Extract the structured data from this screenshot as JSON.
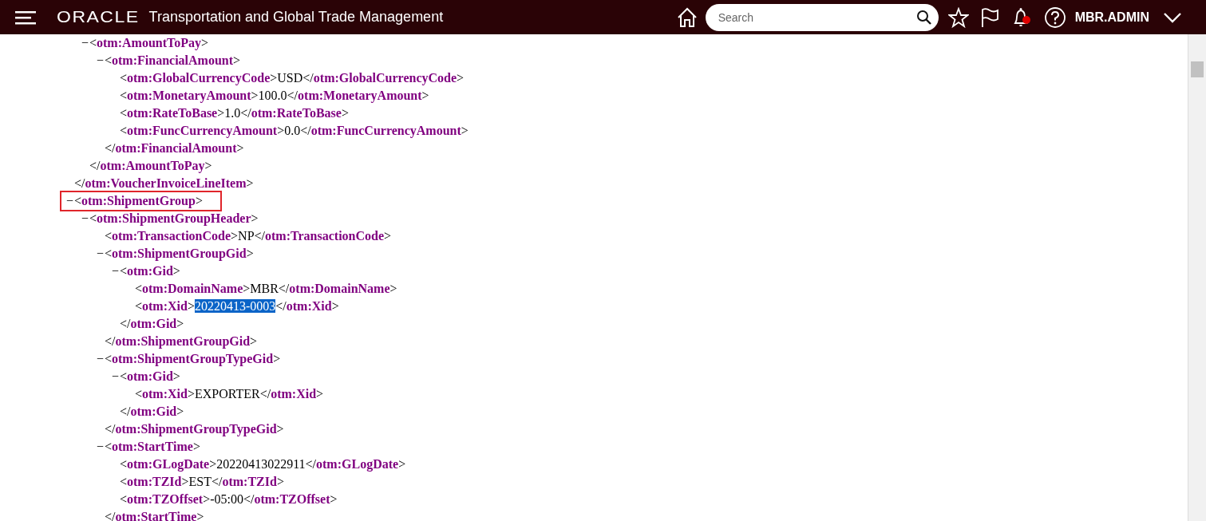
{
  "header": {
    "brand": "ORACLE",
    "title": "Transportation and Global Trade Management",
    "search": {
      "placeholder": "Search"
    },
    "notifications": {
      "unread": true
    },
    "user": "MBR.ADMIN"
  },
  "xml": [
    {
      "close": "</**otm:VoucherInvoiceLineItem**>",
      "children": [
        {
          "toggle": "−",
          "open": "<**otm:AmountToPay**>",
          "close": "</**otm:AmountToPay**>",
          "children": [
            {
              "toggle": "−",
              "open": "<**otm:FinancialAmount**>",
              "close": "</**otm:FinancialAmount**>",
              "children": [
                {
                  "open": "<**otm:GlobalCurrencyCode**>",
                  "value": "USD",
                  "selected": false,
                  "close": "</**otm:GlobalCurrencyCode**>"
                },
                {
                  "open": "<**otm:MonetaryAmount**>",
                  "value": "100.0",
                  "selected": false,
                  "close": "</**otm:MonetaryAmount**>"
                },
                {
                  "open": "<**otm:RateToBase**>",
                  "value": "1.0",
                  "selected": false,
                  "close": "</**otm:RateToBase**>"
                },
                {
                  "open": "<**otm:FuncCurrencyAmount**>",
                  "value": "0.0",
                  "selected": false,
                  "close": "</**otm:FuncCurrencyAmount**>"
                }
              ]
            }
          ]
        }
      ]
    },
    {
      "toggle": "−",
      "open": "<**otm:ShipmentGroup**>",
      "outlined": true,
      "children": [
        {
          "toggle": "−",
          "open": "<**otm:ShipmentGroupHeader**>",
          "children": [
            {
              "open": "<**otm:TransactionCode**>",
              "value": "NP",
              "selected": false,
              "close": "</**otm:TransactionCode**>"
            },
            {
              "toggle": "−",
              "open": "<**otm:ShipmentGroupGid**>",
              "close": "</**otm:ShipmentGroupGid**>",
              "children": [
                {
                  "toggle": "−",
                  "open": "<**otm:Gid**>",
                  "close": "</**otm:Gid**>",
                  "children": [
                    {
                      "open": "<**otm:DomainName**>",
                      "value": "MBR",
                      "selected": false,
                      "close": "</**otm:DomainName**>"
                    },
                    {
                      "open": "<**otm:Xid**>",
                      "value": "20220413-0003",
                      "selected": true,
                      "close": "</**otm:Xid**>"
                    }
                  ]
                }
              ]
            },
            {
              "toggle": "−",
              "open": "<**otm:ShipmentGroupTypeGid**>",
              "close": "</**otm:ShipmentGroupTypeGid**>",
              "children": [
                {
                  "toggle": "−",
                  "open": "<**otm:Gid**>",
                  "close": "</**otm:Gid**>",
                  "children": [
                    {
                      "open": "<**otm:Xid**>",
                      "value": "EXPORTER",
                      "selected": false,
                      "close": "</**otm:Xid**>"
                    }
                  ]
                }
              ]
            },
            {
              "toggle": "−",
              "open": "<**otm:StartTime**>",
              "close": "</**otm:StartTime**>",
              "children": [
                {
                  "open": "<**otm:GLogDate**>",
                  "value": "20220413022911",
                  "selected": false,
                  "close": "</**otm:GLogDate**>"
                },
                {
                  "open": "<**otm:TZId**>",
                  "value": "EST",
                  "selected": false,
                  "close": "</**otm:TZId**>"
                },
                {
                  "open": "<**otm:TZOffset**>",
                  "value": "-05:00",
                  "selected": false,
                  "close": "</**otm:TZOffset**>"
                }
              ]
            }
          ]
        }
      ]
    }
  ]
}
